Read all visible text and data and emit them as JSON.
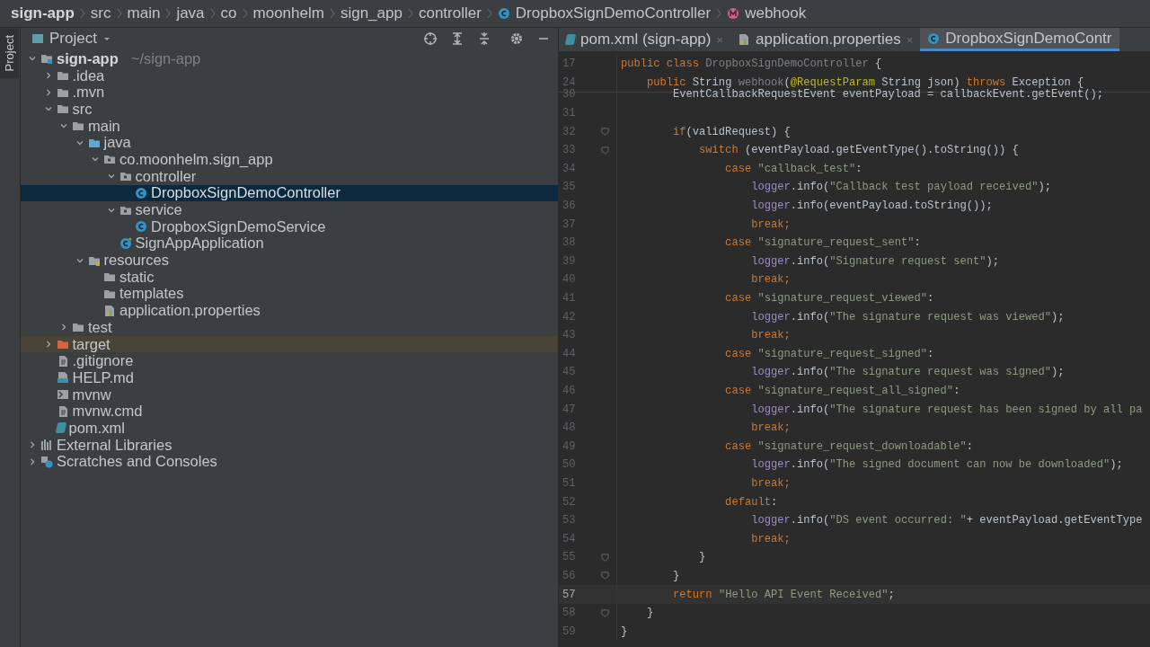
{
  "breadcrumbs": [
    {
      "label": "sign-app"
    },
    {
      "label": "src"
    },
    {
      "label": "main"
    },
    {
      "label": "java"
    },
    {
      "label": "co"
    },
    {
      "label": "moonhelm"
    },
    {
      "label": "sign_app"
    },
    {
      "label": "controller"
    },
    {
      "label": "DropboxSignDemoController",
      "kind": "class"
    },
    {
      "label": "webhook",
      "kind": "method"
    }
  ],
  "side_strip": {
    "label": "Project"
  },
  "project_panel": {
    "title": "Project"
  },
  "tree": [
    {
      "label": "sign-app",
      "hint": "~/sign-app",
      "kind": "module",
      "expanded": true,
      "selected": false,
      "children": [
        {
          "label": ".idea",
          "kind": "folder",
          "expanded": false,
          "selected": false
        },
        {
          "label": ".mvn",
          "kind": "folder",
          "expanded": false,
          "selected": false
        },
        {
          "label": "src",
          "kind": "folder",
          "expanded": true,
          "selected": false,
          "children": [
            {
              "label": "main",
              "kind": "folder",
              "expanded": true,
              "selected": false,
              "children": [
                {
                  "label": "java",
                  "kind": "source-folder",
                  "expanded": true,
                  "selected": false,
                  "children": [
                    {
                      "label": "co.moonhelm.sign_app",
                      "kind": "package",
                      "expanded": true,
                      "selected": false,
                      "children": [
                        {
                          "label": "controller",
                          "kind": "package",
                          "expanded": true,
                          "selected": false,
                          "children": [
                            {
                              "label": "DropboxSignDemoController",
                              "kind": "class",
                              "selected": true
                            }
                          ]
                        },
                        {
                          "label": "service",
                          "kind": "package",
                          "expanded": true,
                          "selected": false,
                          "children": [
                            {
                              "label": "DropboxSignDemoService",
                              "kind": "class",
                              "selected": false
                            }
                          ]
                        },
                        {
                          "label": "SignAppApplication",
                          "kind": "spring-class",
                          "selected": false
                        }
                      ]
                    }
                  ]
                },
                {
                  "label": "resources",
                  "kind": "resources-folder",
                  "expanded": true,
                  "selected": false,
                  "children": [
                    {
                      "label": "static",
                      "kind": "folder",
                      "selected": false
                    },
                    {
                      "label": "templates",
                      "kind": "folder",
                      "selected": false
                    },
                    {
                      "label": "application.properties",
                      "kind": "properties",
                      "selected": false
                    }
                  ]
                }
              ]
            },
            {
              "label": "test",
              "kind": "folder",
              "expanded": false,
              "selected": false
            }
          ]
        },
        {
          "label": "target",
          "kind": "excluded-folder",
          "expanded": false,
          "selected": false
        },
        {
          "label": ".gitignore",
          "kind": "gitignore",
          "selected": false
        },
        {
          "label": "HELP.md",
          "kind": "markdown",
          "selected": false
        },
        {
          "label": "mvnw",
          "kind": "shell",
          "selected": false
        },
        {
          "label": "mvnw.cmd",
          "kind": "text-file",
          "selected": false
        },
        {
          "label": "pom.xml",
          "kind": "maven",
          "selected": false
        }
      ]
    },
    {
      "label": "External Libraries",
      "kind": "libraries",
      "expanded": false,
      "selected": false
    },
    {
      "label": "Scratches and Consoles",
      "kind": "scratches",
      "expanded": false,
      "selected": false
    }
  ],
  "editor_tabs": [
    {
      "label": "pom.xml (sign-app)",
      "kind": "maven",
      "close": "×",
      "selected": false
    },
    {
      "label": "application.properties",
      "kind": "properties",
      "close": "×",
      "selected": false
    },
    {
      "label": "DropboxSignDemoContr",
      "kind": "class",
      "selected": true
    }
  ],
  "sticky_lines": [
    {
      "number": "17",
      "tokens": [
        {
          "kind": "kw",
          "text": "public class "
        },
        {
          "kind": "dim",
          "text": "DropboxSignDemoController"
        },
        {
          "kind": "plain",
          "text": " {"
        }
      ]
    },
    {
      "number": "24",
      "tokens": [
        {
          "kind": "kw",
          "text": "    public "
        },
        {
          "kind": "plain",
          "text": "String "
        },
        {
          "kind": "dim",
          "text": "webhook"
        },
        {
          "kind": "plain",
          "text": "("
        },
        {
          "kind": "ann",
          "text": "@RequestParam"
        },
        {
          "kind": "plain",
          "text": " String json) "
        },
        {
          "kind": "kw",
          "text": "throws "
        },
        {
          "kind": "plain",
          "text": "Exception {"
        }
      ]
    }
  ],
  "code_lines": [
    {
      "number": "30",
      "current": false,
      "fold": false,
      "tokens": [
        {
          "kind": "plain",
          "text": "        EventCallbackRequestEvent eventPayload = callbackEvent.getEvent();"
        }
      ]
    },
    {
      "number": "31",
      "current": false,
      "fold": false
    },
    {
      "number": "32",
      "current": false,
      "fold": true,
      "tokens": [
        {
          "kind": "kw",
          "text": "        if"
        },
        {
          "kind": "plain",
          "text": "(validRequest) {"
        }
      ]
    },
    {
      "number": "33",
      "current": false,
      "fold": true,
      "tokens": [
        {
          "kind": "kw",
          "text": "            switch "
        },
        {
          "kind": "plain",
          "text": "(eventPayload.getEventType().toString()) {"
        }
      ]
    },
    {
      "number": "34",
      "current": false,
      "fold": false,
      "tokens": [
        {
          "kind": "kw",
          "text": "                case "
        },
        {
          "kind": "str",
          "text": "\"callback_test\""
        },
        {
          "kind": "plain",
          "text": ":"
        }
      ]
    },
    {
      "number": "35",
      "current": false,
      "fold": false,
      "tokens": [
        {
          "kind": "field",
          "text": "                    logger"
        },
        {
          "kind": "plain",
          "text": ".info("
        },
        {
          "kind": "str",
          "text": "\"Callback test payload received\""
        },
        {
          "kind": "plain",
          "text": ");"
        }
      ]
    },
    {
      "number": "36",
      "current": false,
      "fold": false,
      "tokens": [
        {
          "kind": "field",
          "text": "                    logger"
        },
        {
          "kind": "plain",
          "text": ".info(eventPayload.toString());"
        }
      ]
    },
    {
      "number": "37",
      "current": false,
      "fold": false,
      "tokens": [
        {
          "kind": "kw",
          "text": "                    break;"
        }
      ]
    },
    {
      "number": "38",
      "current": false,
      "fold": false,
      "tokens": [
        {
          "kind": "kw",
          "text": "                case "
        },
        {
          "kind": "str",
          "text": "\"signature_request_sent\""
        },
        {
          "kind": "plain",
          "text": ":"
        }
      ]
    },
    {
      "number": "39",
      "current": false,
      "fold": false,
      "tokens": [
        {
          "kind": "field",
          "text": "                    logger"
        },
        {
          "kind": "plain",
          "text": ".info("
        },
        {
          "kind": "str",
          "text": "\"Signature request sent\""
        },
        {
          "kind": "plain",
          "text": ");"
        }
      ]
    },
    {
      "number": "40",
      "current": false,
      "fold": false,
      "tokens": [
        {
          "kind": "kw",
          "text": "                    break;"
        }
      ]
    },
    {
      "number": "41",
      "current": false,
      "fold": false,
      "tokens": [
        {
          "kind": "kw",
          "text": "                case "
        },
        {
          "kind": "str",
          "text": "\"signature_request_viewed\""
        },
        {
          "kind": "plain",
          "text": ":"
        }
      ]
    },
    {
      "number": "42",
      "current": false,
      "fold": false,
      "tokens": [
        {
          "kind": "field",
          "text": "                    logger"
        },
        {
          "kind": "plain",
          "text": ".info("
        },
        {
          "kind": "str",
          "text": "\"The signature request was viewed\""
        },
        {
          "kind": "plain",
          "text": ");"
        }
      ]
    },
    {
      "number": "43",
      "current": false,
      "fold": false,
      "tokens": [
        {
          "kind": "kw",
          "text": "                    break;"
        }
      ]
    },
    {
      "number": "44",
      "current": false,
      "fold": false,
      "tokens": [
        {
          "kind": "kw",
          "text": "                case "
        },
        {
          "kind": "str",
          "text": "\"signature_request_signed\""
        },
        {
          "kind": "plain",
          "text": ":"
        }
      ]
    },
    {
      "number": "45",
      "current": false,
      "fold": false,
      "tokens": [
        {
          "kind": "field",
          "text": "                    logger"
        },
        {
          "kind": "plain",
          "text": ".info("
        },
        {
          "kind": "str",
          "text": "\"The signature request was signed\""
        },
        {
          "kind": "plain",
          "text": ");"
        }
      ]
    },
    {
      "number": "46",
      "current": false,
      "fold": false,
      "tokens": [
        {
          "kind": "kw",
          "text": "                case "
        },
        {
          "kind": "str",
          "text": "\"signature_request_all_signed\""
        },
        {
          "kind": "plain",
          "text": ":"
        }
      ]
    },
    {
      "number": "47",
      "current": false,
      "fold": false,
      "tokens": [
        {
          "kind": "field",
          "text": "                    logger"
        },
        {
          "kind": "plain",
          "text": ".info("
        },
        {
          "kind": "str",
          "text": "\"The signature request has been signed by all pa"
        }
      ]
    },
    {
      "number": "48",
      "current": false,
      "fold": false,
      "tokens": [
        {
          "kind": "kw",
          "text": "                    break;"
        }
      ]
    },
    {
      "number": "49",
      "current": false,
      "fold": false,
      "tokens": [
        {
          "kind": "kw",
          "text": "                case "
        },
        {
          "kind": "str",
          "text": "\"signature_request_downloadable\""
        },
        {
          "kind": "plain",
          "text": ":"
        }
      ]
    },
    {
      "number": "50",
      "current": false,
      "fold": false,
      "tokens": [
        {
          "kind": "field",
          "text": "                    logger"
        },
        {
          "kind": "plain",
          "text": ".info("
        },
        {
          "kind": "str",
          "text": "\"The signed document can now be downloaded\""
        },
        {
          "kind": "plain",
          "text": ");"
        }
      ]
    },
    {
      "number": "51",
      "current": false,
      "fold": false,
      "tokens": [
        {
          "kind": "kw",
          "text": "                    break;"
        }
      ]
    },
    {
      "number": "52",
      "current": false,
      "fold": false,
      "tokens": [
        {
          "kind": "kw",
          "text": "                default"
        },
        {
          "kind": "plain",
          "text": ":"
        }
      ]
    },
    {
      "number": "53",
      "current": false,
      "fold": false,
      "tokens": [
        {
          "kind": "field",
          "text": "                    logger"
        },
        {
          "kind": "plain",
          "text": ".info("
        },
        {
          "kind": "str",
          "text": "\"DS event occurred: \""
        },
        {
          "kind": "plain",
          "text": "+ eventPayload.getEventType"
        }
      ]
    },
    {
      "number": "54",
      "current": false,
      "fold": false,
      "tokens": [
        {
          "kind": "kw",
          "text": "                    break;"
        }
      ]
    },
    {
      "number": "55",
      "current": false,
      "fold": true,
      "tokens": [
        {
          "kind": "plain",
          "text": "            }"
        }
      ]
    },
    {
      "number": "56",
      "current": false,
      "fold": true,
      "tokens": [
        {
          "kind": "plain",
          "text": "        }"
        }
      ]
    },
    {
      "number": "57",
      "current": true,
      "fold": false,
      "tokens": [
        {
          "kind": "kw",
          "text": "        return "
        },
        {
          "kind": "str",
          "text": "\"Hello API Event Received\""
        },
        {
          "kind": "plain",
          "text": ";"
        }
      ]
    },
    {
      "number": "58",
      "current": false,
      "fold": true,
      "tokens": [
        {
          "kind": "plain",
          "text": "    }"
        }
      ]
    },
    {
      "number": "59",
      "current": false,
      "fold": false,
      "tokens": [
        {
          "kind": "plain",
          "text": "}"
        }
      ]
    }
  ]
}
